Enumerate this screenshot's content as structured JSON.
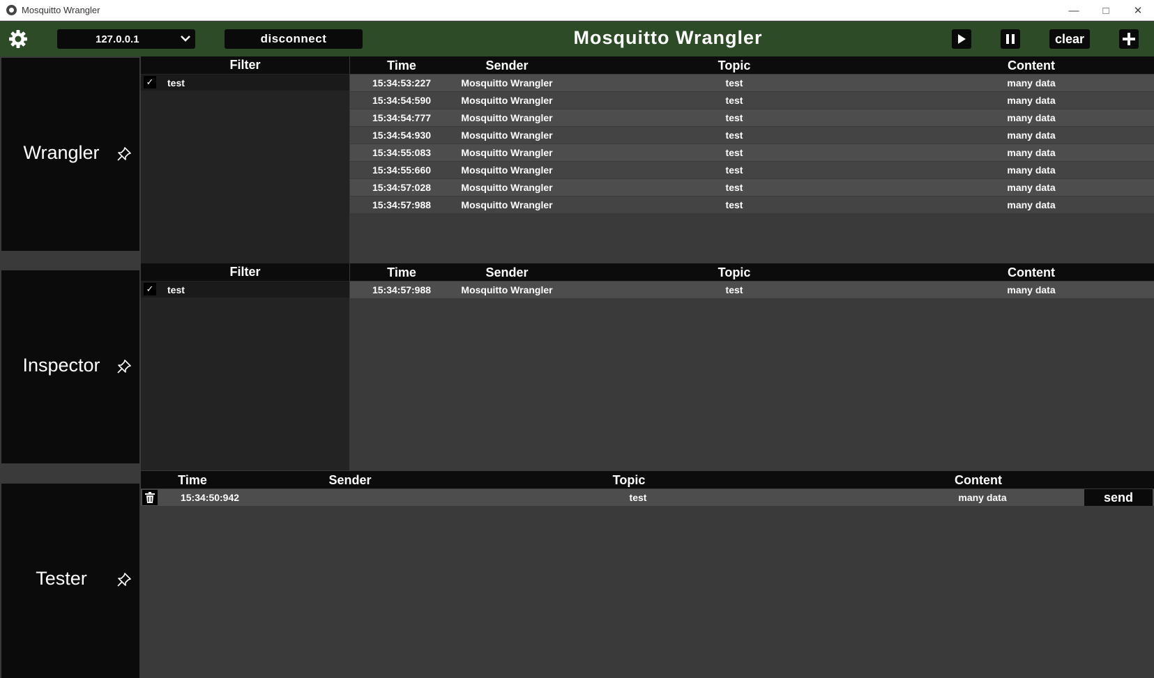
{
  "window": {
    "title": "Mosquitto Wrangler",
    "controls": [
      "minimize",
      "maximize",
      "close"
    ]
  },
  "toolbar": {
    "ip_address": "127.0.0.1",
    "disconnect_label": "disconnect",
    "app_title": "Mosquitto Wrangler",
    "clear_label": "clear"
  },
  "panels": {
    "wrangler": {
      "label": "Wrangler",
      "filter_header": "Filter",
      "filters": [
        {
          "name": "test",
          "checked": true,
          "check_glyph": "✓"
        }
      ],
      "columns": {
        "time": "Time",
        "sender": "Sender",
        "topic": "Topic",
        "content": "Content"
      },
      "messages": [
        {
          "time": "15:34:53:227",
          "sender": "Mosquitto Wrangler",
          "topic": "test",
          "content": "many data"
        },
        {
          "time": "15:34:54:590",
          "sender": "Mosquitto Wrangler",
          "topic": "test",
          "content": "many data"
        },
        {
          "time": "15:34:54:777",
          "sender": "Mosquitto Wrangler",
          "topic": "test",
          "content": "many data"
        },
        {
          "time": "15:34:54:930",
          "sender": "Mosquitto Wrangler",
          "topic": "test",
          "content": "many data"
        },
        {
          "time": "15:34:55:083",
          "sender": "Mosquitto Wrangler",
          "topic": "test",
          "content": "many data"
        },
        {
          "time": "15:34:55:660",
          "sender": "Mosquitto Wrangler",
          "topic": "test",
          "content": "many data"
        },
        {
          "time": "15:34:57:028",
          "sender": "Mosquitto Wrangler",
          "topic": "test",
          "content": "many data"
        },
        {
          "time": "15:34:57:988",
          "sender": "Mosquitto Wrangler",
          "topic": "test",
          "content": "many data"
        }
      ]
    },
    "inspector": {
      "label": "Inspector",
      "filter_header": "Filter",
      "filters": [
        {
          "name": "test",
          "checked": true,
          "check_glyph": "✓"
        }
      ],
      "columns": {
        "time": "Time",
        "sender": "Sender",
        "topic": "Topic",
        "content": "Content"
      },
      "messages": [
        {
          "time": "15:34:57:988",
          "sender": "Mosquitto Wrangler",
          "topic": "test",
          "content": "many data"
        }
      ]
    },
    "tester": {
      "label": "Tester",
      "columns": {
        "time": "Time",
        "sender": "Sender",
        "topic": "Topic",
        "content": "Content"
      },
      "rows": [
        {
          "time": "15:34:50:942",
          "sender": "",
          "topic": "test",
          "content": "many data",
          "send_label": "send"
        }
      ]
    }
  },
  "colors": {
    "toolbar_bg": "#2d4b27",
    "panel_bg": "#3a3a3a",
    "row_odd": "#4d4d4d",
    "row_even": "#444444"
  }
}
